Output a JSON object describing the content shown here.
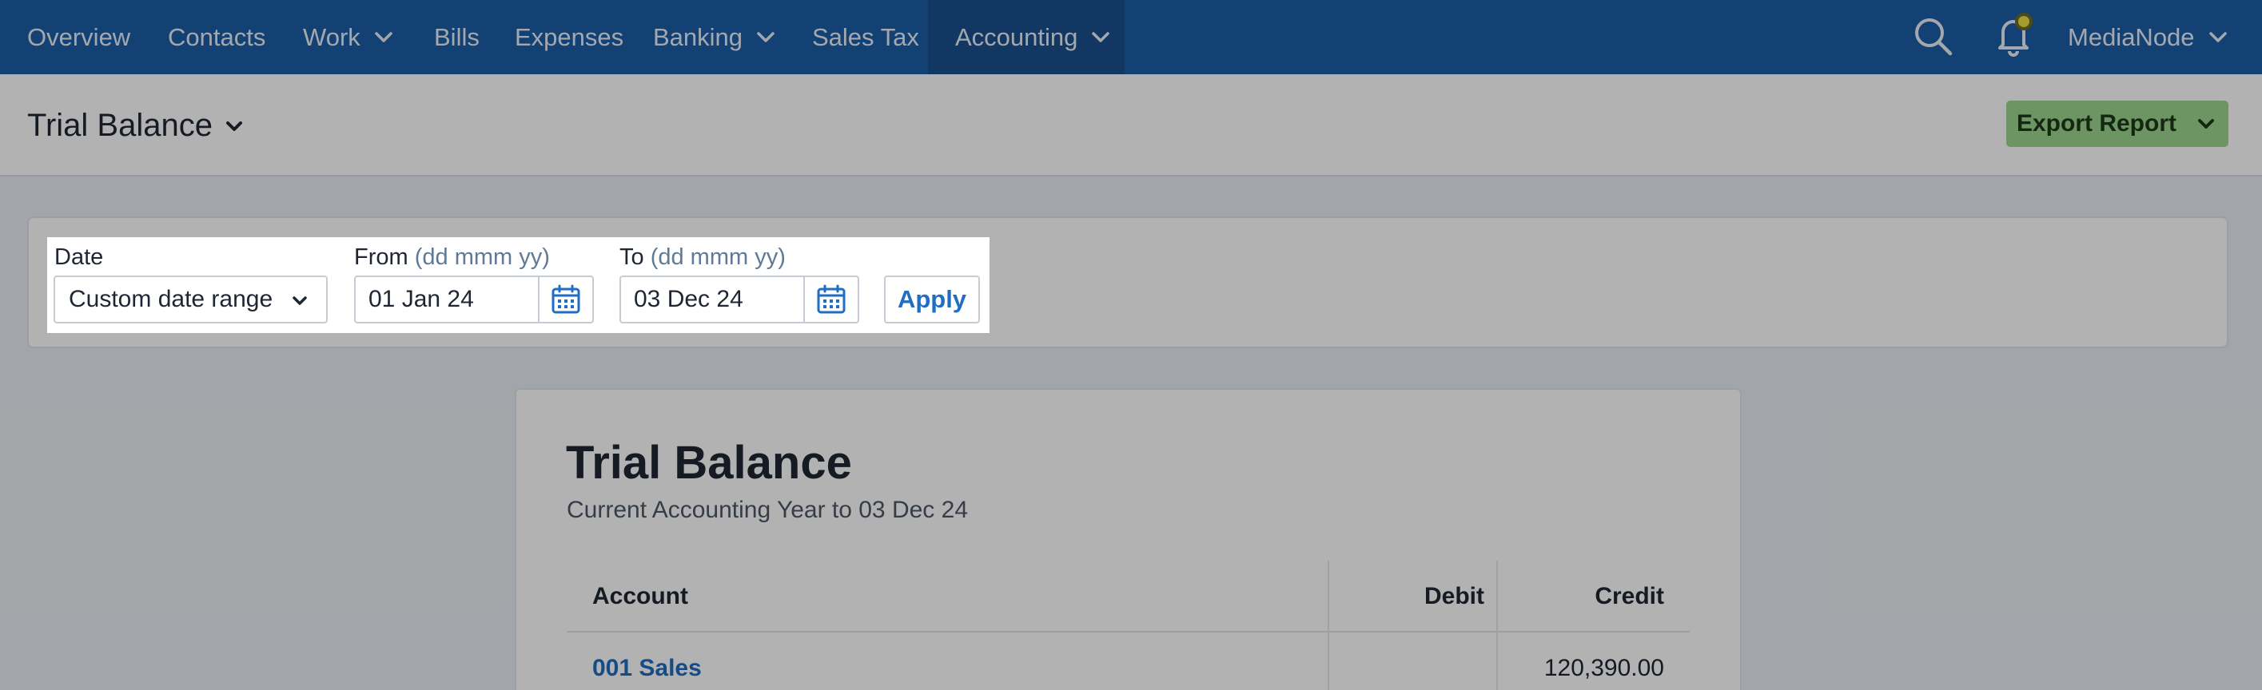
{
  "nav": {
    "items": [
      {
        "label": "Overview",
        "dropdown": false
      },
      {
        "label": "Contacts",
        "dropdown": false
      },
      {
        "label": "Work",
        "dropdown": true
      },
      {
        "label": "Bills",
        "dropdown": false
      },
      {
        "label": "Expenses",
        "dropdown": false
      },
      {
        "label": "Banking",
        "dropdown": true
      },
      {
        "label": "Sales Tax",
        "dropdown": false
      },
      {
        "label": "Accounting",
        "dropdown": true,
        "active": true
      }
    ],
    "user": "MediaNode",
    "icons": [
      "search-icon",
      "bell-icon",
      "chevron-down-icon"
    ],
    "background": "#1d5ea6"
  },
  "header": {
    "title": "Trial Balance",
    "export_label": "Export Report"
  },
  "filters": {
    "date_label": "Date",
    "date_value": "Custom date range",
    "from_label": "From",
    "from_hint": "(dd mmm yy)",
    "from_value": "01 Jan 24",
    "to_label": "To",
    "to_hint": "(dd mmm yy)",
    "to_value": "03 Dec 24",
    "apply_label": "Apply"
  },
  "report": {
    "title": "Trial Balance",
    "subtitle": "Current Accounting Year to 03 Dec 24",
    "columns": [
      "Account",
      "Debit",
      "Credit"
    ],
    "rows": [
      {
        "account": "001 Sales",
        "debit": "",
        "credit": "120,390.00"
      }
    ]
  },
  "colors": {
    "accent": "#1f6ec2",
    "export_button": "#9bd68f",
    "notification_dot": "#e8e04a"
  }
}
